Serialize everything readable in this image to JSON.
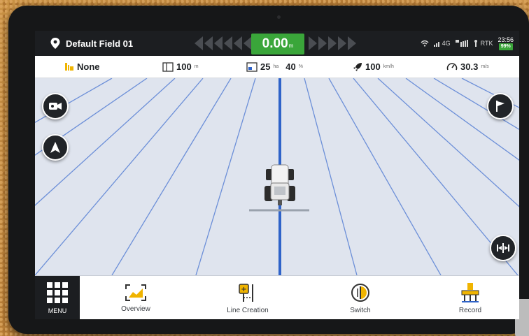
{
  "status_bar": {
    "field_name": "Default Field 01",
    "offset_value": "0.00",
    "offset_unit": "m",
    "network": "4G",
    "positioning": "RTK",
    "time": "23:56",
    "battery": "99%"
  },
  "info_bar": {
    "implement": "None",
    "width_value": "100",
    "width_unit": "m",
    "area_value": "25",
    "area_unit": "ha",
    "area_percent_value": "40",
    "area_percent_unit": "%",
    "speed_value": "100",
    "speed_unit": "km/h",
    "gauge_value": "30.3",
    "gauge_unit": "m/s"
  },
  "bottom_bar": {
    "menu_label": "MENU",
    "tools": [
      {
        "label": "Overview",
        "icon": "overview-icon"
      },
      {
        "label": "Line Creation",
        "icon": "line-creation-icon"
      },
      {
        "label": "Switch",
        "icon": "switch-icon"
      },
      {
        "label": "Record",
        "icon": "record-icon"
      }
    ]
  },
  "map_controls": {
    "camera": "camera-icon",
    "navigation": "navigation-arrow-icon",
    "flag": "flag-icon",
    "align": "align-center-icon"
  },
  "colors": {
    "accent_green": "#3aa63a",
    "guidance_line": "#2f63c9",
    "parallel_lines": "#6c8fd8",
    "icon_yellow": "#f0b400"
  }
}
